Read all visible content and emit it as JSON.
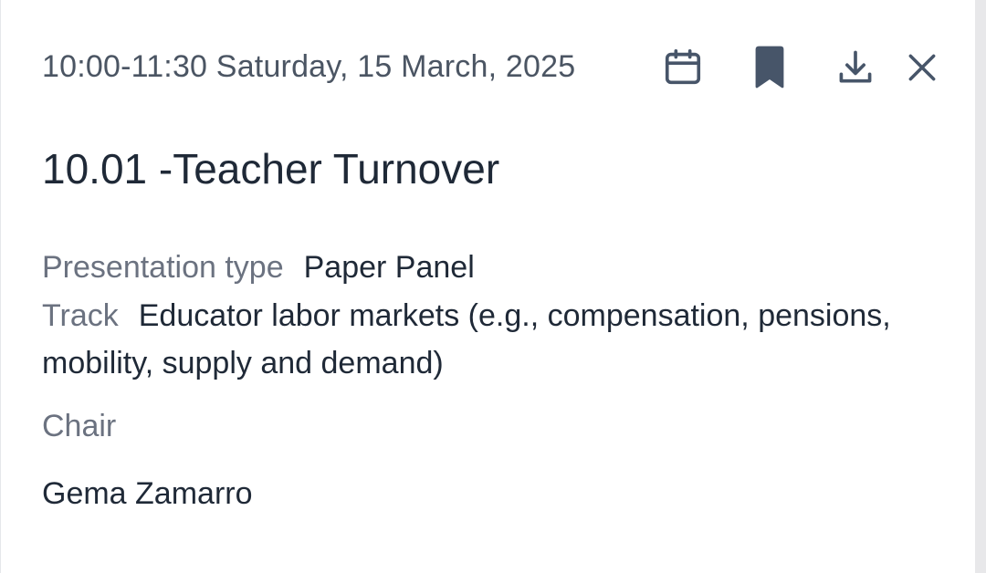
{
  "session": {
    "datetime": "10:00-11:30 Saturday, 15 March, 2025",
    "title": "10.01 -Teacher Turnover",
    "presentation_type_label": "Presentation type",
    "presentation_type_value": "Paper Panel",
    "track_label": "Track",
    "track_value": "Educator labor markets (e.g., compensation, pensions, mobility, supply and demand)",
    "chair_label": "Chair",
    "chair_name": "Gema Zamarro"
  },
  "actions": {
    "calendar_icon": "calendar-icon",
    "bookmark_icon": "bookmark-icon",
    "download_icon": "download-icon",
    "close_icon": "close-icon"
  },
  "colors": {
    "text_primary": "#1f2937",
    "text_muted": "#6b7280",
    "icon": "#475569"
  }
}
